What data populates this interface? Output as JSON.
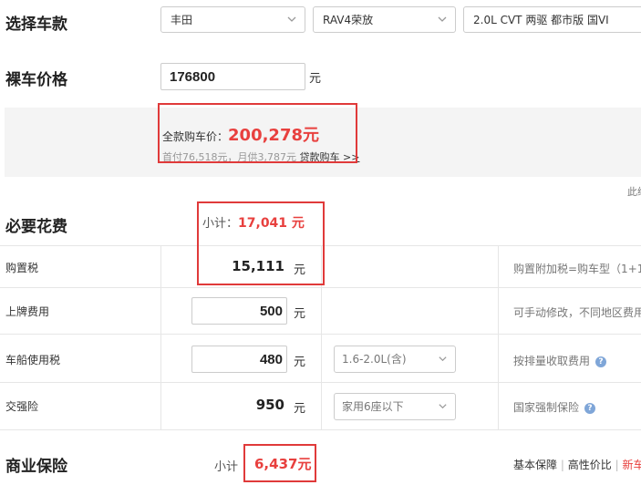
{
  "select_car": {
    "title": "选择车款",
    "brand": "丰田",
    "model": "RAV4荣放",
    "version": "2.0L CVT 两驱 都市版 国VI"
  },
  "bare_price": {
    "title": "裸车价格",
    "value": "176800",
    "unit": "元"
  },
  "full_price": {
    "label": "全款购车价：",
    "value": "200,278元",
    "loan_info": "首付76,518元，月供3,787元",
    "loan_link": "贷款购车 >>"
  },
  "right_cut": "此续",
  "required": {
    "title": "必要花费",
    "subtotal_label": "小计：",
    "subtotal_value": "17,041 元",
    "rows": [
      {
        "label": "购置税",
        "value": "15,111",
        "unit": "元",
        "note": "购置附加税=购车型（1+1"
      },
      {
        "label": "上牌费用",
        "value": "500",
        "unit": "元",
        "note": "可手动修改，不同地区费用"
      },
      {
        "label": "车船使用税",
        "value": "480",
        "unit": "元",
        "option": "1.6-2.0L(含)",
        "note": "按排量收取费用"
      },
      {
        "label": "交强险",
        "value": "950",
        "unit": "元",
        "option": "家用6座以下",
        "note": "国家强制保险"
      }
    ]
  },
  "commercial": {
    "title": "商业保险",
    "subtotal_label": "小计",
    "subtotal_value": "6,437元",
    "tabs": [
      "基本保障",
      "高性价比",
      "新车"
    ],
    "separator": "|"
  },
  "colors": {
    "accent_red": "#e8403e",
    "box_red": "#e03a3a",
    "help_blue": "#7fa6d8"
  }
}
